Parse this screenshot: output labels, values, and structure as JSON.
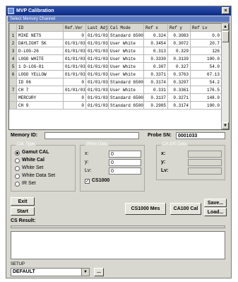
{
  "window": {
    "title": "MVP Calibration",
    "close": "×",
    "selection_bar": "Select Memory Channel"
  },
  "grid": {
    "columns": [
      "",
      "ID",
      "Ref.Ver",
      "Last Adj",
      "Cal Mode",
      "Ref x",
      "Ref y",
      "Ref Lv"
    ],
    "rows": [
      [
        "1",
        "MIKE NETS",
        "0",
        "01/01/03",
        "Standard 6500",
        "0.324",
        "0.3083",
        "0.0"
      ],
      [
        "2",
        "DAYLIGHT 5K",
        "01/01/03",
        "01/01/03",
        "User White",
        "0.3454",
        "0.3072",
        "20.7"
      ],
      [
        "3",
        "D-LOG-26",
        "01/01/03",
        "01/01/03",
        "User White",
        "0.313",
        "0.329",
        "126"
      ],
      [
        "4",
        "LOGO WHITE",
        "01/01/03",
        "01/01/03",
        "User White",
        "0.3330",
        "0.3139",
        "100.0"
      ],
      [
        "5",
        "1 D-LOG-81",
        "01/01/03",
        "01/01/03",
        "User White",
        "0.307",
        "0.327",
        "54.0"
      ],
      [
        "6",
        "LOGO YELLOW",
        "01/01/03",
        "01/01/03",
        "User White",
        "0.3371",
        "0.3763",
        "67.13"
      ],
      [
        "",
        "ID 06",
        "0",
        "01/01/03",
        "Standard 6500",
        "0.3174",
        "0.3297",
        "54.2"
      ],
      [
        "7",
        "CH 7",
        "01/01/03",
        "01/01/03",
        "User White",
        "0.331",
        "0.3361",
        "176.5"
      ],
      [
        "",
        "MERCURY",
        "0",
        "01/01/03",
        "Standard 6500",
        "0.3137",
        "0.3271",
        "148.0"
      ],
      [
        "",
        "CH 9",
        "0",
        "01/01/03",
        "Standard 6500",
        "0.2905",
        "0.3174",
        "190.0"
      ]
    ]
  },
  "memory": {
    "id_label": "Memory ID:",
    "id_value": "",
    "probe_label": "Probe SN:",
    "probe_value": "0001033"
  },
  "cal_type": {
    "title": "Cal. Type",
    "options": [
      "Gamut CAL",
      "White Cal",
      "White Set",
      "White Data Set",
      "IR Set"
    ],
    "selected_index": 0
  },
  "white_data": {
    "title": "White Data",
    "x_label": "x:",
    "y_label": "y:",
    "lv_label": "Lv:",
    "x_value": "0",
    "y_value": "0",
    "lv_value": "0",
    "checkbox_label": "CS1000",
    "checkbox_checked": true
  },
  "ca_data": {
    "title": "CA 100 Data",
    "x_label": "x:",
    "y_label": "y:",
    "lv_label": "Lv:",
    "x_value": "",
    "y_value": "",
    "lv_value": ""
  },
  "buttons": {
    "exit": "Exit",
    "start": "Start",
    "cs1000": "CS1000 Mes",
    "ca100": "CA100 Cal",
    "save": "Save...",
    "load": "Load..."
  },
  "results": {
    "label": "CS Result:",
    "value": ""
  },
  "setup": {
    "label": "SETUP",
    "value": "DEFAULT",
    "browse": "..."
  },
  "colors": {
    "title_bar": "#0a2a88",
    "selection": "#5a78c0",
    "window_bg": "#d8d8d0"
  }
}
